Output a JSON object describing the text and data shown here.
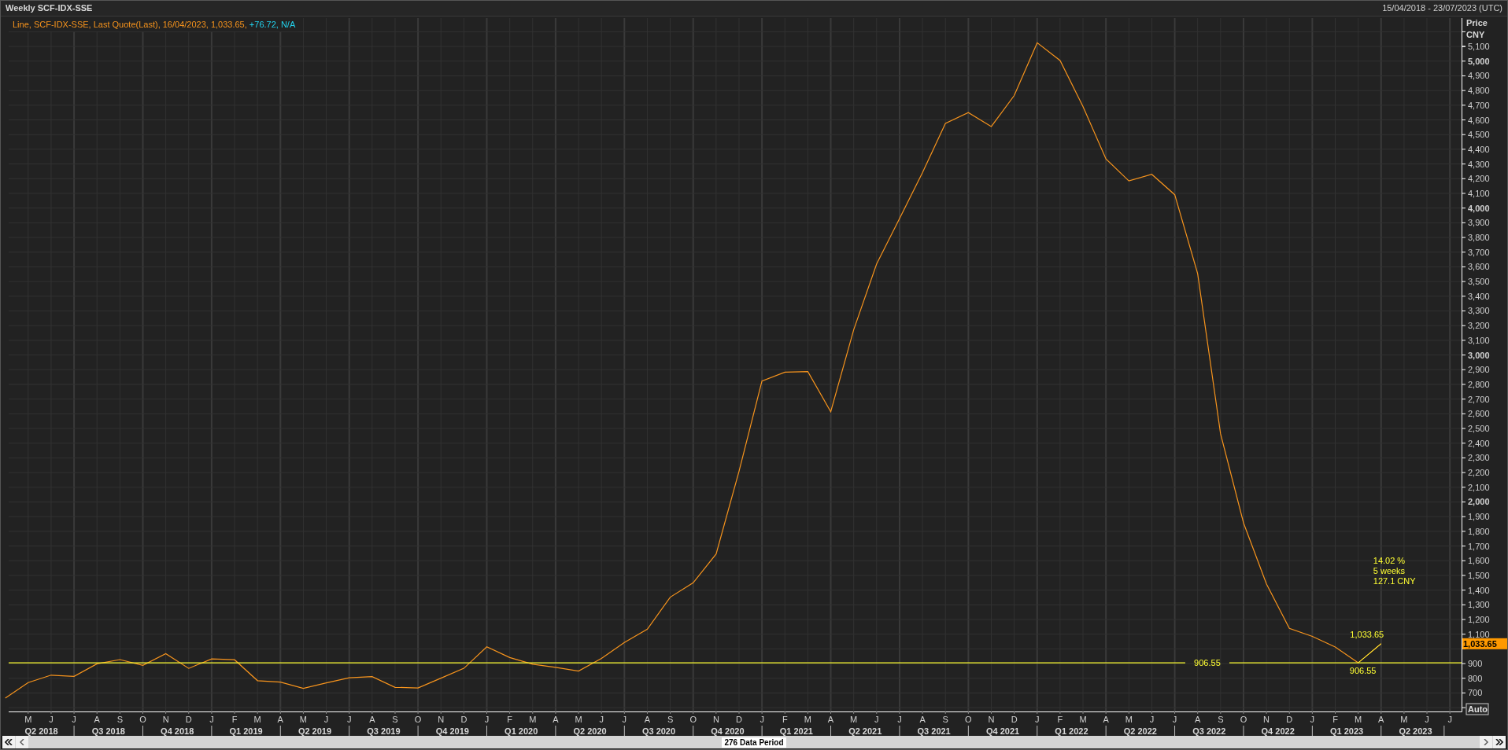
{
  "header": {
    "title": "Weekly SCF-IDX-SSE",
    "date_range": "15/04/2018 - 23/07/2023 (UTC)"
  },
  "legend": [
    {
      "kind": "info",
      "text": "Line, SCF-IDX-SSE, Last Quote(Last), 16/04/2023, 1,033.65,"
    },
    {
      "kind": "change",
      "text": "+76.72, N/A"
    }
  ],
  "chart": {
    "axis_title": "Price",
    "axis_unit": "CNY",
    "scale_mode": "Auto",
    "quarters": [
      "Q2 2018",
      "Q3 2018",
      "Q4 2018",
      "Q1 2019",
      "Q2 2019",
      "Q3 2019",
      "Q4 2019",
      "Q1 2020",
      "Q2 2020",
      "Q3 2020",
      "Q4 2020",
      "Q1 2021",
      "Q2 2021",
      "Q3 2021",
      "Q4 2021",
      "Q1 2022",
      "Q2 2022",
      "Q3 2022",
      "Q4 2022",
      "Q1 2023",
      "Q2 2023"
    ],
    "reference_line": {
      "label": "906.55"
    },
    "trend": {
      "start_label": "906.55",
      "end_label": "1,033.65"
    },
    "trend_stats": [
      "14.02 %",
      "5 weeks",
      "127.1 CNY"
    ],
    "last_price": "1,033.65",
    "chart_data": {
      "type": "line",
      "grid": true,
      "categories": [
        null,
        "M",
        "J",
        "J",
        "A",
        "S",
        "O",
        "N",
        "D",
        "J",
        "F",
        "M",
        "A",
        "M",
        "J",
        "J",
        "A",
        "S",
        "O",
        "N",
        "D",
        "J",
        "F",
        "M",
        "A",
        "M",
        "J",
        "J",
        "A",
        "S",
        "O",
        "N",
        "D",
        "J",
        "F",
        "M",
        "A",
        "M",
        "J",
        "J",
        "A",
        "S",
        "O",
        "N",
        "D",
        "J",
        "F",
        "M",
        "A",
        "M",
        "J",
        "J",
        "A",
        "S",
        "O",
        "N",
        "D",
        "J",
        "F",
        "M",
        "A",
        "M",
        "J",
        "J"
      ],
      "series": [
        {
          "color": "#f7941d",
          "values": [
            665,
            771,
            821,
            813,
            898,
            927,
            888,
            968,
            867,
            932,
            926,
            784,
            774,
            731,
            769,
            803,
            811,
            738,
            734,
            801,
            868,
            1014,
            941,
            896,
            874,
            849,
            935,
            1043,
            1134,
            1352,
            1450,
            1646,
            2209,
            2823,
            2883,
            2887,
            2614,
            3172,
            3620,
            3928,
            4242,
            4576,
            4650,
            4555,
            4766,
            5125,
            5004,
            4691,
            4334,
            4185,
            4230,
            4091,
            3553,
            2463,
            1857,
            1442,
            1140,
            1085,
            1013,
            905,
            1035,
            null,
            null,
            null
          ]
        }
      ],
      "ylim": [
        574,
        5293
      ],
      "yticks": [
        {
          "value": 700,
          "label": "700"
        },
        {
          "value": 800,
          "label": "800"
        },
        {
          "value": 900,
          "label": "900"
        },
        {
          "value": 1100,
          "label": "1,100"
        },
        {
          "value": 1200,
          "label": "1,200"
        },
        {
          "value": 1300,
          "label": "1,300"
        },
        {
          "value": 1400,
          "label": "1,400"
        },
        {
          "value": 1500,
          "label": "1,500"
        },
        {
          "value": 1600,
          "label": "1,600"
        },
        {
          "value": 1700,
          "label": "1,700"
        },
        {
          "value": 1800,
          "label": "1,800"
        },
        {
          "value": 1900,
          "label": "1,900"
        },
        {
          "value": 2000,
          "label": "2,000"
        },
        {
          "value": 2100,
          "label": "2,100"
        },
        {
          "value": 2200,
          "label": "2,200"
        },
        {
          "value": 2300,
          "label": "2,300"
        },
        {
          "value": 2400,
          "label": "2,400"
        },
        {
          "value": 2500,
          "label": "2,500"
        },
        {
          "value": 2600,
          "label": "2,600"
        },
        {
          "value": 2700,
          "label": "2,700"
        },
        {
          "value": 2800,
          "label": "2,800"
        },
        {
          "value": 2900,
          "label": "2,900"
        },
        {
          "value": 3000,
          "label": "3,000"
        },
        {
          "value": 3100,
          "label": "3,100"
        },
        {
          "value": 3200,
          "label": "3,200"
        },
        {
          "value": 3300,
          "label": "3,300"
        },
        {
          "value": 3400,
          "label": "3,400"
        },
        {
          "value": 3500,
          "label": "3,500"
        },
        {
          "value": 3600,
          "label": "3,600"
        },
        {
          "value": 3700,
          "label": "3,700"
        },
        {
          "value": 3800,
          "label": "3,800"
        },
        {
          "value": 3900,
          "label": "3,900"
        },
        {
          "value": 4000,
          "label": "4,000"
        },
        {
          "value": 4100,
          "label": "4,100"
        },
        {
          "value": 4200,
          "label": "4,200"
        },
        {
          "value": 4300,
          "label": "4,300"
        },
        {
          "value": 4400,
          "label": "4,400"
        },
        {
          "value": 4500,
          "label": "4,500"
        },
        {
          "value": 4600,
          "label": "4,600"
        },
        {
          "value": 4700,
          "label": "4,700"
        },
        {
          "value": 4800,
          "label": "4,800"
        },
        {
          "value": 4900,
          "label": "4,900"
        },
        {
          "value": 5000,
          "label": "5,000"
        },
        {
          "value": 5100,
          "label": "5,100"
        }
      ]
    }
  },
  "scroll_bar": {
    "label": "276 Data Period"
  }
}
